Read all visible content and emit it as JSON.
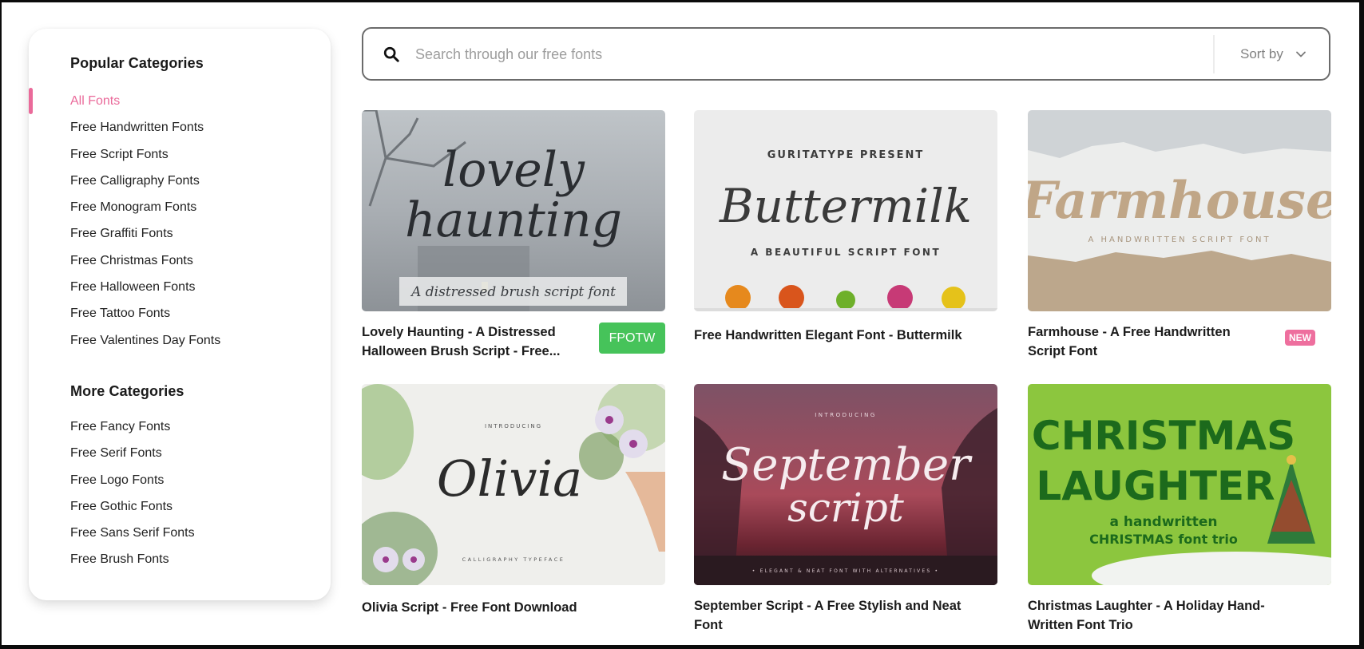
{
  "sidebar": {
    "popular_heading": "Popular Categories",
    "popular": [
      {
        "label": "All Fonts",
        "active": true
      },
      {
        "label": "Free Handwritten Fonts"
      },
      {
        "label": "Free Script Fonts"
      },
      {
        "label": "Free Calligraphy Fonts"
      },
      {
        "label": "Free Monogram Fonts"
      },
      {
        "label": "Free Graffiti Fonts"
      },
      {
        "label": "Free Christmas Fonts"
      },
      {
        "label": "Free Halloween Fonts"
      },
      {
        "label": "Free Tattoo Fonts"
      },
      {
        "label": "Free Valentines Day Fonts"
      }
    ],
    "more_heading": "More Categories",
    "more": [
      {
        "label": "Free Fancy Fonts"
      },
      {
        "label": "Free Serif Fonts"
      },
      {
        "label": "Free Logo Fonts"
      },
      {
        "label": "Free Gothic Fonts"
      },
      {
        "label": "Free Sans Serif Fonts"
      },
      {
        "label": "Free Brush Fonts"
      }
    ]
  },
  "search": {
    "icon": "search-icon",
    "placeholder": "Search through our free fonts",
    "value": "",
    "sort_label": "Sort by",
    "sort_icon": "chevron-down-icon"
  },
  "colors": {
    "accent": "#ea6a9a",
    "fpotw_badge": "#46c35a",
    "new_badge": "#ee6f9e"
  },
  "cards": [
    {
      "title": "Lovely Haunting - A Distressed Halloween Brush Script - Free...",
      "badge": "FPOTW",
      "image": {
        "line1": "lovely",
        "line2": "haunting",
        "caption": "A distressed brush script font"
      }
    },
    {
      "title": "Free Handwritten Elegant Font - Buttermilk",
      "image": {
        "top": "GURITATYPE PRESENT",
        "name": "Buttermilk",
        "caption": "A BEAUTIFUL SCRIPT FONT"
      }
    },
    {
      "title": "Farmhouse - A Free Handwritten Script Font",
      "badge": "NEW",
      "image": {
        "name": "Farmhouse",
        "caption": "A HANDWRITTEN SCRIPT FONT"
      }
    },
    {
      "title": "Olivia Script - Free Font Download",
      "image": {
        "top": "INTRODUCING",
        "name": "Olivia",
        "caption": "CALLIGRAPHY TYPEFACE"
      }
    },
    {
      "title": "September Script - A Free Stylish and Neat Font",
      "image": {
        "top": "INTRODUCING",
        "line1": "September",
        "line2": "script",
        "caption": "• ELEGANT & NEAT FONT WITH ALTERNATIVES •"
      }
    },
    {
      "title": "Christmas Laughter - A Holiday Hand-Written Font Trio",
      "image": {
        "line1": "CHRISTMAS",
        "line2": "LAUGHTER",
        "caption1": "a handwritten",
        "caption2": "CHRISTMAS font trio"
      }
    }
  ]
}
